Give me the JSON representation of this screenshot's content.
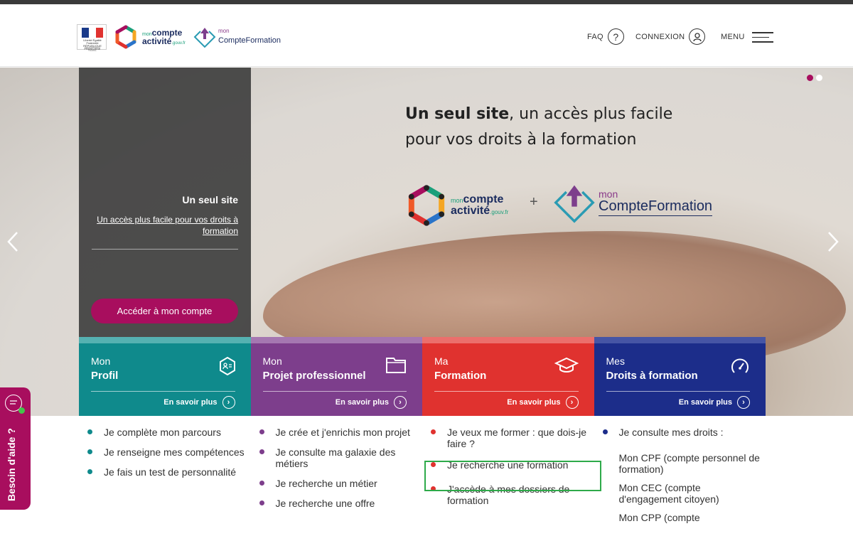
{
  "header": {
    "logo_rf_line1": "Liberté Égalité Fraternité",
    "logo_rf_line2": "RÉPUBLIQUE FRANÇAISE",
    "logo_rf_line3": "MINISTÈRE DU TRAVAIL",
    "mca_mon": "mon",
    "mca_compte": "compte",
    "mca_activite": "activité",
    "mca_gouv": ".gouv.fr",
    "mcf_mon": "mon",
    "mcf_name": "CompteFormation",
    "faq_label": "FAQ",
    "faq_icon": "?",
    "connexion_label": "CONNEXION",
    "menu_label": "MENU"
  },
  "hero": {
    "panel_title": "Un seul site",
    "panel_link": "Un accès plus facile pour vos droits à formation",
    "panel_button": "Accéder à mon compte",
    "title_bold": "Un seul site",
    "title_rest": ", un accès plus facile",
    "title_line2": "pour vos droits à la formation",
    "plus": "+",
    "mca_mon": "mon",
    "mca_compte": "compte",
    "mca_activite": "activité",
    "mca_gouv": ".gouv.fr",
    "mcf_mon": "mon",
    "mcf_name": "CompteFormation"
  },
  "cards": [
    {
      "line1": "Mon",
      "line2": "Profil",
      "more": "En savoir plus",
      "color": "#0f8a8c",
      "top": "#56b7b3",
      "icon": "profile-icon"
    },
    {
      "line1": "Mon",
      "line2": "Projet professionnel",
      "more": "En savoir plus",
      "color": "#7d3e8c",
      "top": "#b08ab8",
      "icon": "folder-icon"
    },
    {
      "line1": "Ma",
      "line2": "Formation",
      "more": "En savoir plus",
      "color": "#e0322f",
      "top": "#f08a84",
      "icon": "graduation-cap-icon"
    },
    {
      "line1": "Mes",
      "line2": "Droits à formation",
      "more": "En savoir plus",
      "color": "#1c2d8a",
      "top": "#4a58a8",
      "icon": "gauge-icon"
    }
  ],
  "lists": {
    "profil": [
      "Je complète mon parcours",
      "Je renseigne mes compétences",
      "Je fais un test de personnalité"
    ],
    "projet": [
      "Je crée et j'enrichis mon projet",
      "Je consulte ma galaxie des métiers",
      "Je recherche un métier",
      "Je recherche une offre"
    ],
    "formation": [
      "Je veux me former : que dois-je faire ?",
      "Je recherche une formation",
      "J'accède à mes dossiers de formation"
    ],
    "droits_head": "Je consulte mes droits :",
    "droits_sub": [
      "Mon CPF (compte personnel de formation)",
      "Mon CEC (compte d'engagement citoyen)",
      "Mon CPP (compte"
    ]
  },
  "help": {
    "label": "Besoin d'aide ?"
  },
  "colors": {
    "accent": "#a80e5e",
    "highlight": "#2eaa4a"
  }
}
